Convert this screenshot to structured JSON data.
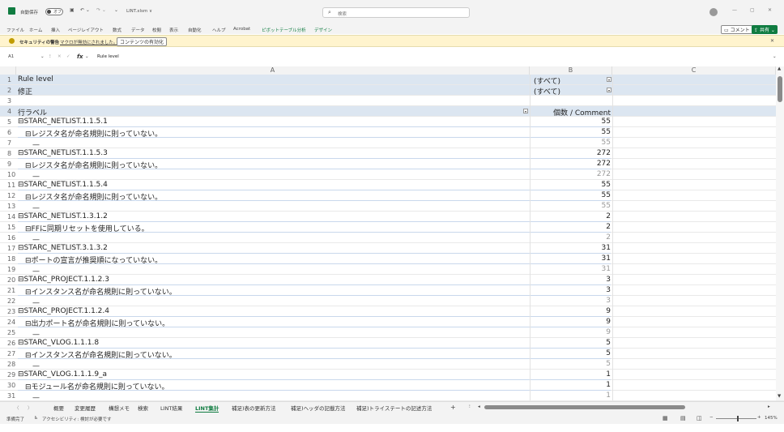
{
  "titlebar": {
    "autosave": "自動保存",
    "autosave_state": "オフ",
    "filename": "LINT.xlsm ∨",
    "search_placeholder": "検索"
  },
  "menu": [
    "ファイル",
    "ホーム",
    "挿入",
    "ページレイアウト",
    "数式",
    "データ",
    "校閲",
    "表示",
    "自動化",
    "ヘルプ",
    "Acrobat",
    "ピボットテーブル分析",
    "デザイン"
  ],
  "comment_btn": "コメント",
  "share_btn": "共有",
  "security": {
    "label": "セキュリティの警告",
    "message": "マクロが無効にされました。",
    "enable_btn": "コンテンツの有効化"
  },
  "formula": {
    "namebox": "A1",
    "value": "Rule level"
  },
  "columns": [
    "A",
    "B",
    "C"
  ],
  "rows": [
    {
      "n": "1",
      "a": "Rule level",
      "b": "(すべて)",
      "dropdown": true,
      "filter": true
    },
    {
      "n": "2",
      "a": "修正",
      "b": "(すべて)",
      "dropdown": true,
      "filter": true
    },
    {
      "n": "3",
      "a": "",
      "b": ""
    },
    {
      "n": "4",
      "a": "行ラベル",
      "b": "個数 / Comment",
      "hdr": true
    },
    {
      "n": "5",
      "a": "⊟STARC_NETLIST.1.1.5.1",
      "b": "55"
    },
    {
      "n": "6",
      "a": "　⊟レジスタ名が命名規則に則っていない。",
      "b": "55"
    },
    {
      "n": "7",
      "a": "　　—",
      "b": "55",
      "grey": true
    },
    {
      "n": "8",
      "a": "⊟STARC_NETLIST.1.1.5.3",
      "b": "272"
    },
    {
      "n": "9",
      "a": "　⊟レジスタ名が命名規則に則っていない。",
      "b": "272"
    },
    {
      "n": "10",
      "a": "　　—",
      "b": "272",
      "grey": true
    },
    {
      "n": "11",
      "a": "⊟STARC_NETLIST.1.1.5.4",
      "b": "55"
    },
    {
      "n": "12",
      "a": "　⊟レジスタ名が命名規則に則っていない。",
      "b": "55"
    },
    {
      "n": "13",
      "a": "　　—",
      "b": "55",
      "grey": true
    },
    {
      "n": "14",
      "a": "⊟STARC_NETLIST.1.3.1.2",
      "b": "2"
    },
    {
      "n": "15",
      "a": "　⊟FFに同期リセットを使用している。",
      "b": "2"
    },
    {
      "n": "16",
      "a": "　　—",
      "b": "2",
      "grey": true
    },
    {
      "n": "17",
      "a": "⊟STARC_NETLIST.3.1.3.2",
      "b": "31"
    },
    {
      "n": "18",
      "a": "　⊟ポートの宣言が推奨順になっていない。",
      "b": "31"
    },
    {
      "n": "19",
      "a": "　　—",
      "b": "31",
      "grey": true
    },
    {
      "n": "20",
      "a": "⊟STARC_PROJECT.1.1.2.3",
      "b": "3"
    },
    {
      "n": "21",
      "a": "　⊟インスタンス名が命名規則に則っていない。",
      "b": "3"
    },
    {
      "n": "22",
      "a": "　　—",
      "b": "3",
      "grey": true
    },
    {
      "n": "23",
      "a": "⊟STARC_PROJECT.1.1.2.4",
      "b": "9"
    },
    {
      "n": "24",
      "a": "　⊟出力ポート名が命名規則に則っていない。",
      "b": "9"
    },
    {
      "n": "25",
      "a": "　　—",
      "b": "9",
      "grey": true
    },
    {
      "n": "26",
      "a": "⊟STARC_VLOG.1.1.1.8",
      "b": "5"
    },
    {
      "n": "27",
      "a": "　⊟インスタンス名が命名規則に則っていない。",
      "b": "5"
    },
    {
      "n": "28",
      "a": "　　—",
      "b": "5",
      "grey": true
    },
    {
      "n": "29",
      "a": "⊟STARC_VLOG.1.1.1.9_a",
      "b": "1"
    },
    {
      "n": "30",
      "a": "　⊟モジュール名が命名規則に則っていない。",
      "b": "1"
    },
    {
      "n": "31",
      "a": "　　—",
      "b": "1",
      "grey": true
    }
  ],
  "tabs": [
    "概要",
    "変更履歴",
    "構想メモ",
    "検索",
    "LINT結果",
    "LINT集計",
    "補足)表の更新方法",
    "補足)ヘッダの記載方法",
    "補足)トライステートの記述方法"
  ],
  "active_tab": "LINT集計",
  "status": {
    "ready": "準備完了",
    "accessibility": "アクセシビリティ: 検討が必要です",
    "zoom": "145%"
  }
}
